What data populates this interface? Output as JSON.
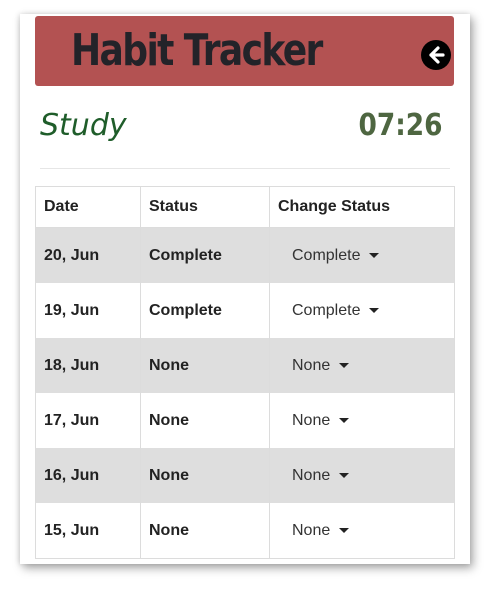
{
  "header": {
    "title": "Habit Tracker",
    "back_icon": "arrow-left-circle-icon"
  },
  "habit": {
    "name": "Study",
    "time": "07:26"
  },
  "table": {
    "columns": [
      "Date",
      "Status",
      "Change Status"
    ],
    "rows": [
      {
        "date": "20, Jun",
        "status": "Complete",
        "selected": "Complete"
      },
      {
        "date": "19, Jun",
        "status": "Complete",
        "selected": "Complete"
      },
      {
        "date": "18, Jun",
        "status": "None",
        "selected": "None"
      },
      {
        "date": "17, Jun",
        "status": "None",
        "selected": "None"
      },
      {
        "date": "16, Jun",
        "status": "None",
        "selected": "None"
      },
      {
        "date": "15, Jun",
        "status": "None",
        "selected": "None"
      }
    ]
  },
  "colors": {
    "header_bg": "#b35252",
    "title_text": "#232329",
    "habit_name": "#1f5d2a",
    "clock": "#4e6641",
    "stripe_row": "#dedede"
  }
}
